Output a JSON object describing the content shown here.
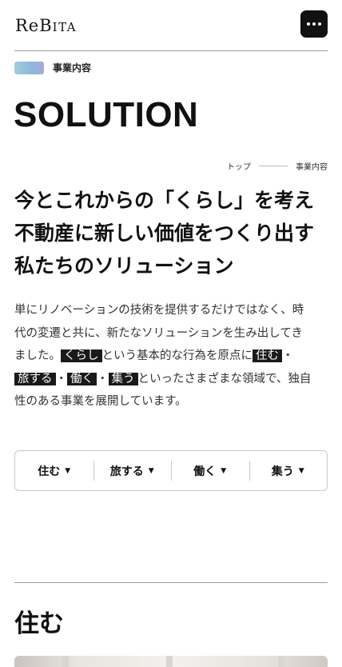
{
  "header": {
    "logo_prefix": "ReB",
    "logo_suffix": "ITA"
  },
  "section": {
    "label": "事業内容"
  },
  "page": {
    "title": "SOLUTION"
  },
  "breadcrumb": {
    "home": "トップ",
    "current": "事業内容"
  },
  "headline": {
    "lines": [
      "今とこれからの「くらし」を考え",
      "不動産に新しい価値をつくり出す",
      "私たちのソリューション"
    ]
  },
  "body": {
    "l1": "単にリノベーションの技術を提供するだけではなく、時",
    "l2": "代の変遷と共に、新たなソリューションを生み出してき",
    "l3_a": "ました。",
    "l3_h1": "くらし",
    "l3_b": "という基本的な行為を原点に",
    "l3_h2": "住む",
    "l3_c": "・",
    "l4_h1": "旅する",
    "l4_a": "・",
    "l4_h2": "働く",
    "l4_b": "・",
    "l4_h3": "集う",
    "l4_c": "といったさまざまな領域で、独自",
    "l5": "性のある事業を展開しています。"
  },
  "tabs": [
    {
      "label": "住む",
      "icon": "caret-down-icon"
    },
    {
      "label": "旅する",
      "icon": "caret-down-icon"
    },
    {
      "label": "働く",
      "icon": "caret-down-icon"
    },
    {
      "label": "集う",
      "icon": "caret-down-icon"
    }
  ],
  "caret": "▼",
  "subsection": {
    "title": "住む"
  },
  "colors": {
    "accent_gradient": [
      "#9fd0db",
      "#8cb8dc",
      "#a9a7d9"
    ],
    "highlight": "#1a1a1a"
  }
}
